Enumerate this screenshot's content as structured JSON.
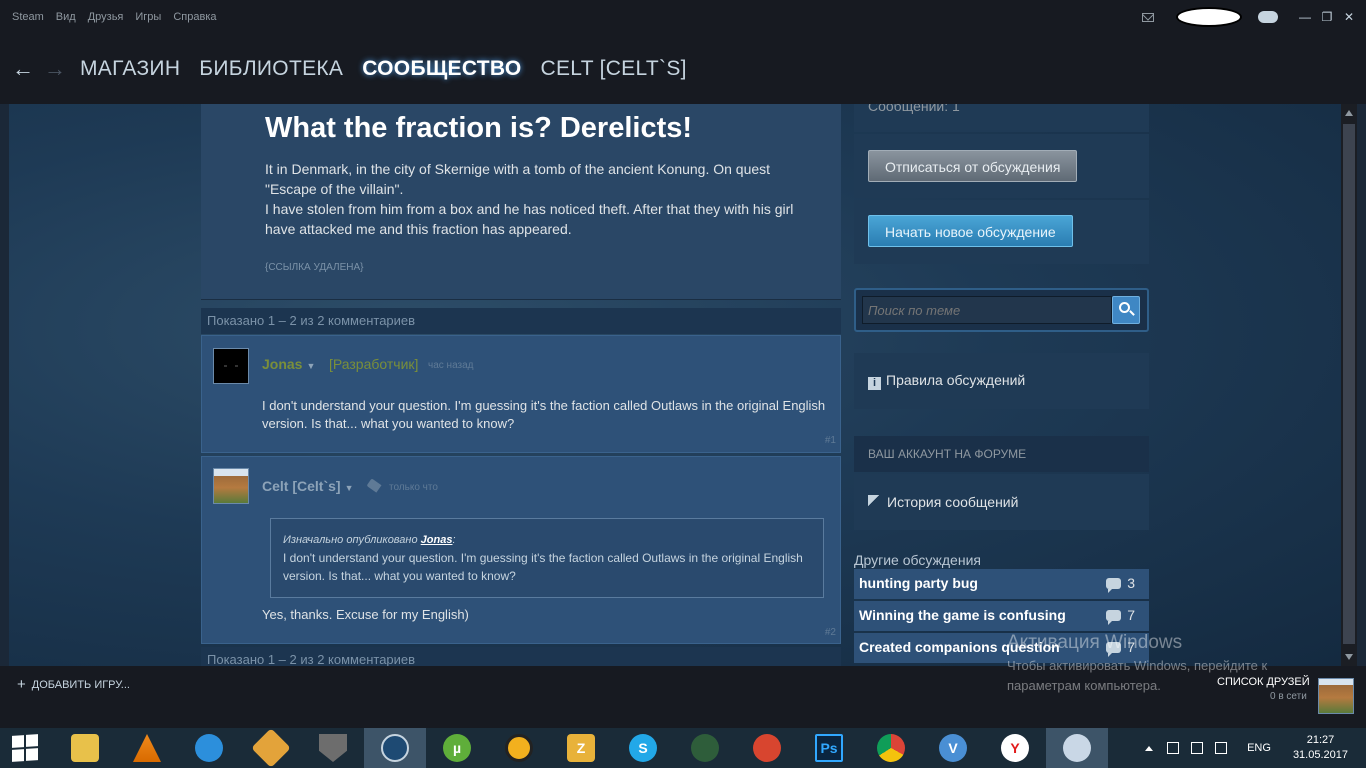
{
  "titlebar": {
    "menu": [
      "Steam",
      "Вид",
      "Друзья",
      "Игры",
      "Справка"
    ]
  },
  "nav": {
    "back": "←",
    "forward": "→",
    "links": [
      "МАГАЗИН",
      "БИБЛИОТЕКА",
      "СООБЩЕСТВО",
      "CELT [CELT`S]"
    ],
    "active": "СООБЩЕСТВО"
  },
  "post": {
    "title": "What the fraction is? Derelicts!",
    "body": "It in Denmark, in the city of Skernige with a tomb of the ancient Konung. On quest \"Escape of the villain\".\nI have stolen from him from a box and he has noticed theft. After that they with his girl have attacked me and this fraction has appeared.",
    "link_removed": "{ССЫЛКА УДАЛЕНА}"
  },
  "comments_count": "Показано 1 – 2 из 2 комментариев",
  "comments": [
    {
      "author": "Jonas",
      "role": "[Разработчик]",
      "time": "час назад",
      "text": "I don't understand your question. I'm guessing it's the faction called Outlaws in the original English version. Is that... what you wanted to know?",
      "number": "#1"
    },
    {
      "author": "Celt [Celt`s]",
      "time": "только что",
      "quote_prefix": "Изначально опубликовано",
      "quote_author": "Jonas",
      "quote_suffix": ":",
      "quote_text": "I don't understand your question. I'm guessing it's the faction called Outlaws in the original English version. Is that... what you wanted to know?",
      "text": "Yes, thanks. Excuse for my English)",
      "number": "#2"
    }
  ],
  "sidebar": {
    "messages_label": "Сообщений: 1",
    "unsubscribe": "Отписаться от обсуждения",
    "new_discussion": "Начать новое обсуждение",
    "search_placeholder": "Поиск по теме",
    "rules": "Правила обсуждений",
    "account_heading": "ВАШ АККАУНТ НА ФОРУМЕ",
    "history": "История сообщений",
    "other_title": "Другие обсуждения",
    "other": [
      {
        "title": "hunting party bug",
        "count": "3"
      },
      {
        "title": "Winning the game is confusing",
        "count": "7"
      },
      {
        "title": "Created companions question",
        "count": "7"
      }
    ]
  },
  "footer": {
    "add_game": "ДОБАВИТЬ ИГРУ...",
    "friends_label": "СПИСОК ДРУЗЕЙ",
    "friends_online": "0 в сети"
  },
  "watermark": {
    "title": "Активация Windows",
    "text": "Чтобы активировать Windows, перейдите к параметрам компьютера."
  },
  "taskbar": {
    "lang": "ENG",
    "time": "21:27",
    "date": "31.05.2017",
    "apps": [
      "explorer",
      "vlc",
      "sync",
      "game",
      "world-of-tanks",
      "steam",
      "utorrent",
      "aimp",
      "z-app",
      "skype",
      "media",
      "ccleaner",
      "photoshop",
      "chrome",
      "vk",
      "yandex",
      "paint"
    ],
    "app_labels": {
      "photoshop": "Ps",
      "utorrent": "µ",
      "z-app": "Z",
      "skype": "S",
      "vk": "V",
      "yandex": "Y"
    }
  },
  "colors": {
    "steam_bg": "#171a21",
    "page_bg": "#1b2838",
    "accent_blue": "#4aa5d6",
    "dev_green": "#7a8f3a"
  }
}
